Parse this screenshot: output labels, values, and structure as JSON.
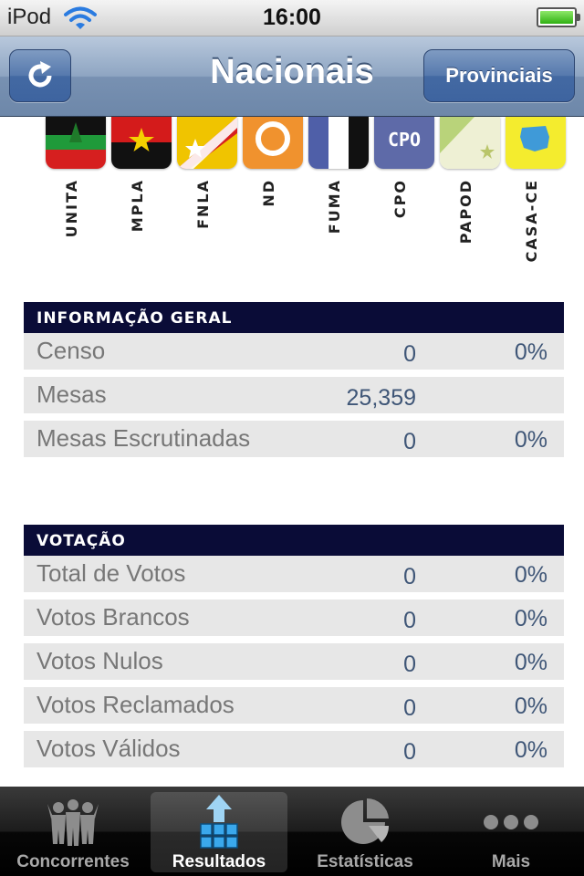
{
  "status_bar": {
    "carrier": "iPod",
    "time": "16:00"
  },
  "nav": {
    "title": "Nacionais",
    "right_button": "Provinciais",
    "left_icon": "refresh-icon"
  },
  "parties": [
    "UNITA",
    "MPLA",
    "FNLA",
    "ND",
    "FUMA",
    "CPO",
    "PAPOD",
    "CASA-CE"
  ],
  "flag_text": {
    "cpo": "CPO"
  },
  "info_geral": {
    "title": "INFORMAÇÃO GERAL",
    "rows": [
      {
        "label": "Censo",
        "value": "0",
        "pct": "0%"
      },
      {
        "label": "Mesas",
        "value": "25,359",
        "pct": ""
      },
      {
        "label": "Mesas Escrutinadas",
        "value": "0",
        "pct": "0%"
      }
    ]
  },
  "votacao": {
    "title": "VOTAÇÃO",
    "rows": [
      {
        "label": "Total de Votos",
        "value": "0",
        "pct": "0%"
      },
      {
        "label": "Votos Brancos",
        "value": "0",
        "pct": "0%"
      },
      {
        "label": "Votos Nulos",
        "value": "0",
        "pct": "0%"
      },
      {
        "label": "Votos Reclamados",
        "value": "0",
        "pct": "0%"
      },
      {
        "label": "Votos Válidos",
        "value": "0",
        "pct": "0%"
      }
    ]
  },
  "tabs": [
    {
      "label": "Concorrentes",
      "icon": "people-icon",
      "active": false
    },
    {
      "label": "Resultados",
      "icon": "bar-chart-icon",
      "active": true
    },
    {
      "label": "Estatísticas",
      "icon": "pie-chart-icon",
      "active": false
    },
    {
      "label": "Mais",
      "icon": "more-icon",
      "active": false
    }
  ]
}
